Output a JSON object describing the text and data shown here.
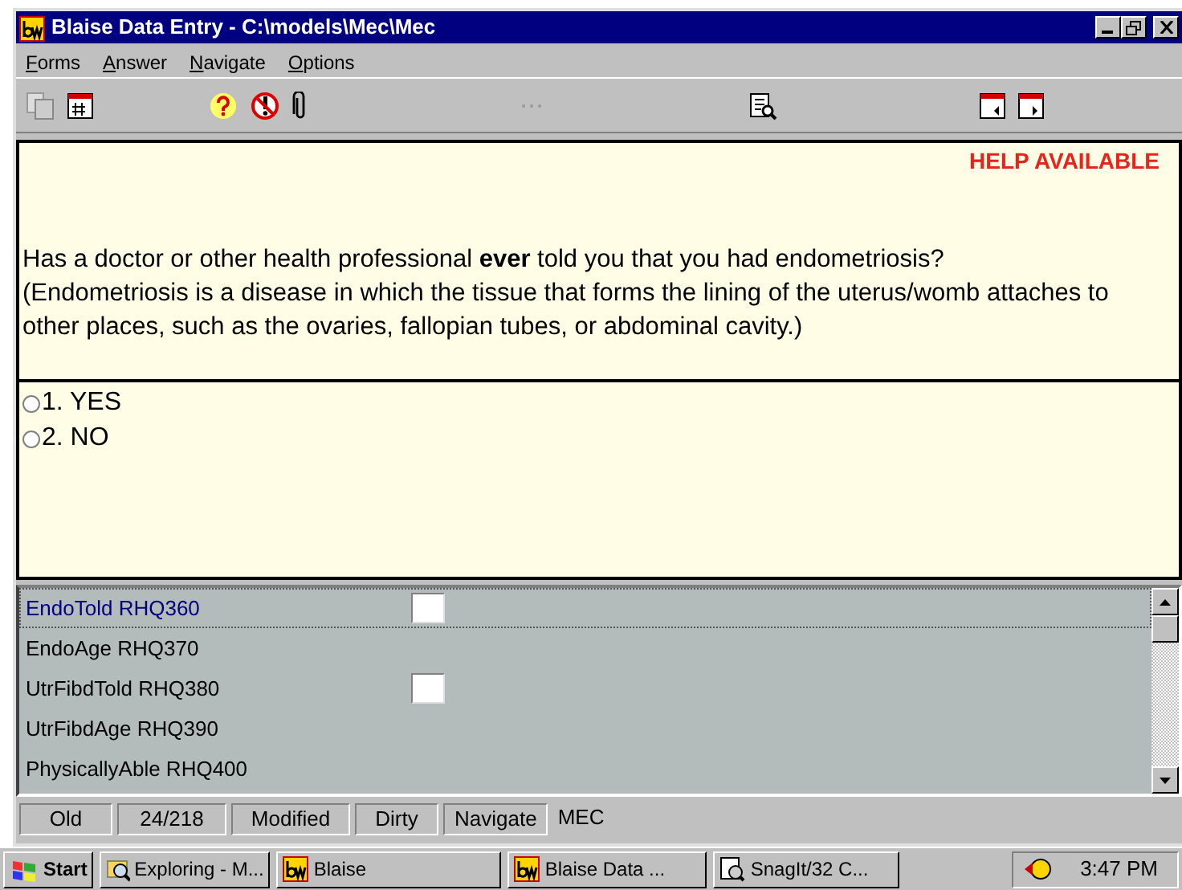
{
  "window": {
    "title": "Blaise Data Entry - C:\\models\\Mec\\Mec"
  },
  "menu": [
    "Forms",
    "Answer",
    "Navigate",
    "Options"
  ],
  "question": {
    "help": "HELP AVAILABLE",
    "text": "Has a doctor or other health professional **ever** told you that you had endometriosis?",
    "note": "(Endometriosis is a disease in which the tissue that forms the lining of the uterus/womb attaches to other places, such as the ovaries, fallopian tubes, or abdominal cavity.)"
  },
  "answers": [
    {
      "label": "1. YES",
      "selected": false
    },
    {
      "label": "2. NO",
      "selected": false
    }
  ],
  "fields": [
    {
      "label": "EndoTold RHQ360",
      "kind": "box",
      "selected": true
    },
    {
      "label": "EndoAge RHQ370",
      "kind": "plain",
      "selected": false
    },
    {
      "label": "UtrFibdTold RHQ380",
      "kind": "box",
      "selected": false
    },
    {
      "label": "UtrFibdAge RHQ390",
      "kind": "plain",
      "selected": false
    },
    {
      "label": "PhysicallyAble RHQ400",
      "kind": "plain",
      "selected": false
    }
  ],
  "status_bar": [
    "Old",
    "24/218",
    "Modified",
    "Dirty",
    "Navigate",
    "MEC"
  ],
  "taskbar": {
    "start": "Start",
    "tasks": [
      {
        "label": "Exploring - M...",
        "kind": "explorer"
      },
      {
        "label": "Blaise",
        "kind": "blaise"
      },
      {
        "label": "Blaise Data ...",
        "kind": "blaise"
      },
      {
        "label": "SnagIt/32 C...",
        "kind": "snagit"
      }
    ],
    "clock": "3:47 PM"
  }
}
